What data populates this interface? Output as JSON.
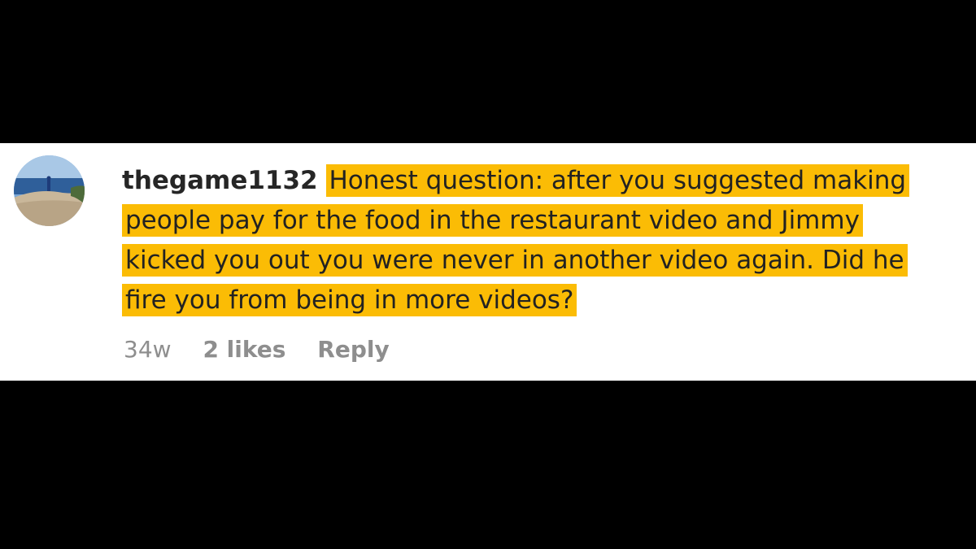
{
  "comment": {
    "username": "thegame1132",
    "text": "Honest question: after you suggested making people pay for the food in the restaurant video and Jimmy kicked you out you were never in another video again. Did he fire you from being in more videos?",
    "time": "34w",
    "likes": "2 likes",
    "reply": "Reply",
    "highlight_color": "#fbbc05"
  }
}
